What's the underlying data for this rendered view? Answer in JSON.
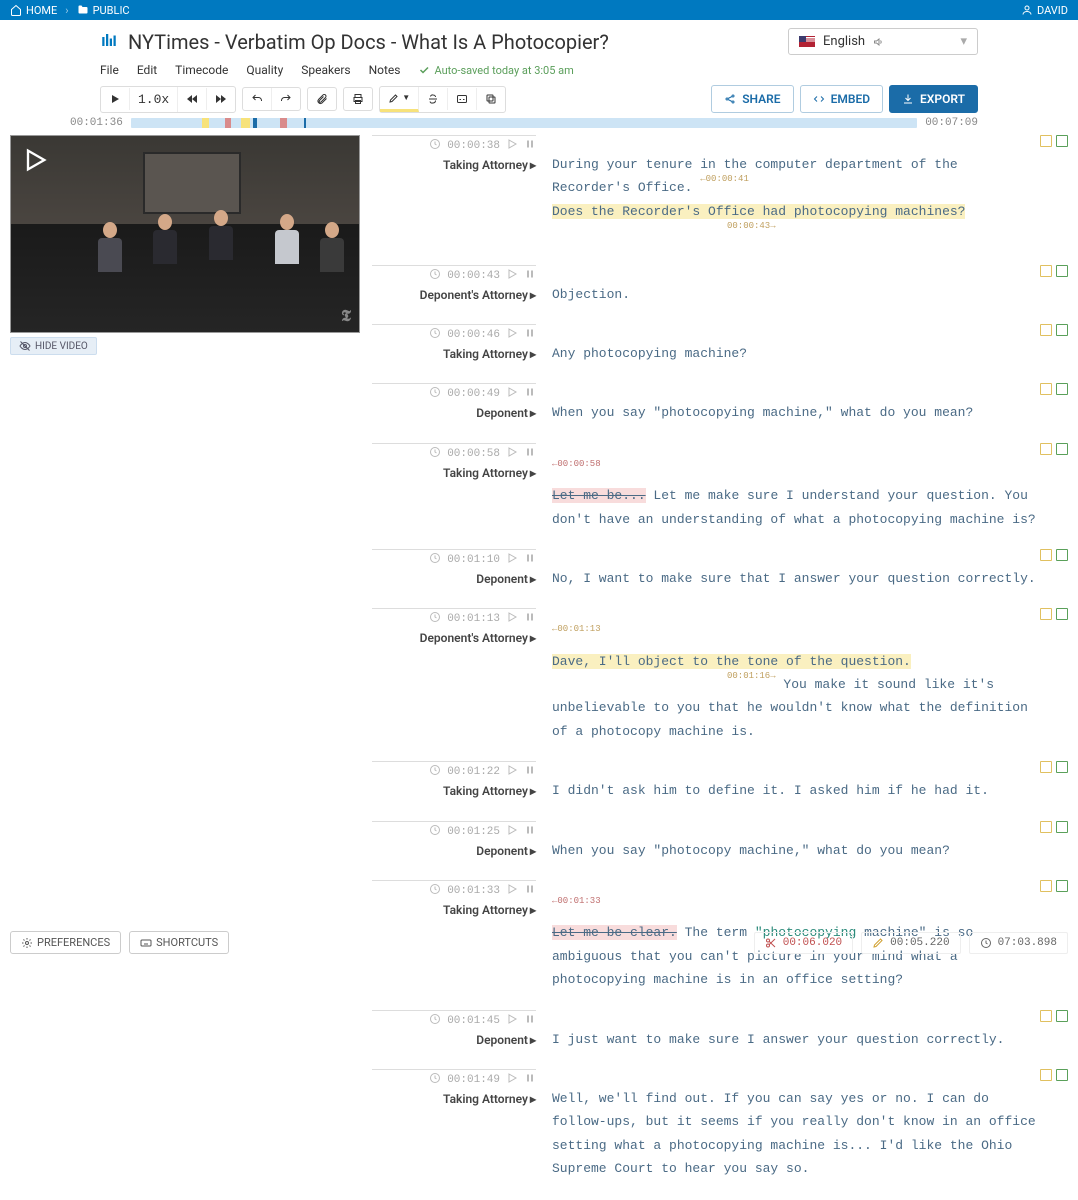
{
  "nav": {
    "home": "HOME",
    "public": "PUBLIC",
    "user": "DAVID"
  },
  "title": "NYTimes - Verbatim Op Docs - What Is A Photocopier?",
  "language": "English",
  "menu": {
    "file": "File",
    "edit": "Edit",
    "timecode": "Timecode",
    "quality": "Quality",
    "speakers": "Speakers",
    "notes": "Notes"
  },
  "autosave": "Auto-saved today at 3:05 am",
  "toolbar": {
    "speed": "1.0x"
  },
  "actions": {
    "share": "SHARE",
    "embed": "EMBED",
    "export": "EXPORT"
  },
  "timeline": {
    "current": "00:01:36",
    "total": "00:07:09"
  },
  "hide_video": "HIDE VIDEO",
  "footer": {
    "preferences": "PREFERENCES",
    "shortcuts": "SHORTCUTS",
    "cut": "00:06.020",
    "edited": "00:05.220",
    "duration": "07:03.898"
  },
  "segments": [
    {
      "tc": "00:00:38",
      "speaker": "Taking Attorney",
      "parts": [
        {
          "t": "During your tenure in the computer department of the Recorder's Office."
        },
        {
          "t": " "
        },
        {
          "mini": "←00:00:41"
        },
        {
          "t": "Does the Recorder's Office had photocopying machines?",
          "cls": "hl"
        },
        {
          "mini": "00:00:43→",
          "after": true
        }
      ]
    },
    {
      "tc": "00:00:43",
      "speaker": "Deponent's Attorney",
      "parts": [
        {
          "t": "Objection."
        }
      ]
    },
    {
      "tc": "00:00:46",
      "speaker": "Taking Attorney",
      "parts": [
        {
          "t": "Any photocopying machine?"
        }
      ]
    },
    {
      "tc": "00:00:49",
      "speaker": "Deponent",
      "parts": [
        {
          "t": "When you say \"photocopying machine,\" what do you mean?"
        }
      ]
    },
    {
      "tc": "00:00:58",
      "speaker": "Taking Attorney",
      "parts": [
        {
          "mini": "←00:00:58",
          "red": true
        },
        {
          "t": "Let me be...",
          "cls": "strike"
        },
        {
          "t": " Let me make sure I understand your question. You don't have an understanding of what a photocopying machine is?"
        }
      ]
    },
    {
      "tc": "00:01:10",
      "speaker": "Deponent",
      "parts": [
        {
          "t": "No, I want to make sure that I answer your question correctly."
        }
      ]
    },
    {
      "tc": "00:01:13",
      "speaker": "Deponent's Attorney",
      "parts": [
        {
          "mini": "←00:01:13"
        },
        {
          "t": "Dave, I'll object to the tone of the question.",
          "cls": "hl"
        },
        {
          "mini": "00:01:16→",
          "after": true
        },
        {
          "t": " You make it sound like it's unbelievable to you that he wouldn't know what the definition of a photocopy machine is."
        }
      ]
    },
    {
      "tc": "00:01:22",
      "speaker": "Taking Attorney",
      "parts": [
        {
          "t": "I didn't ask him to define it. I asked him if he had it."
        }
      ]
    },
    {
      "tc": "00:01:25",
      "speaker": "Deponent",
      "parts": [
        {
          "t": "When you say \"photocopy machine,\" what do you mean?"
        }
      ]
    },
    {
      "tc": "00:01:33",
      "speaker": "Taking Attorney",
      "parts": [
        {
          "mini": "←00:01:33",
          "red": true
        },
        {
          "t": "Let me be clear.",
          "cls": "strike"
        },
        {
          "t": " The term "
        },
        {
          "t": "\"photocopying",
          "cls": "quoted"
        },
        {
          "t": " machine\" is so ambiguous that you can't picture in your mind what a photocopying machine is in an office setting?"
        }
      ]
    },
    {
      "tc": "00:01:45",
      "speaker": "Deponent",
      "parts": [
        {
          "t": "I just want to make sure I answer your question correctly."
        }
      ]
    },
    {
      "tc": "00:01:49",
      "speaker": "Taking Attorney",
      "parts": [
        {
          "t": "Well, we'll find out. If you can say yes or no. I can do follow-ups, but it seems if you really don't know in an office setting what a photocopying machine is... I'd like the Ohio Supreme Court to hear you say so."
        }
      ]
    }
  ]
}
